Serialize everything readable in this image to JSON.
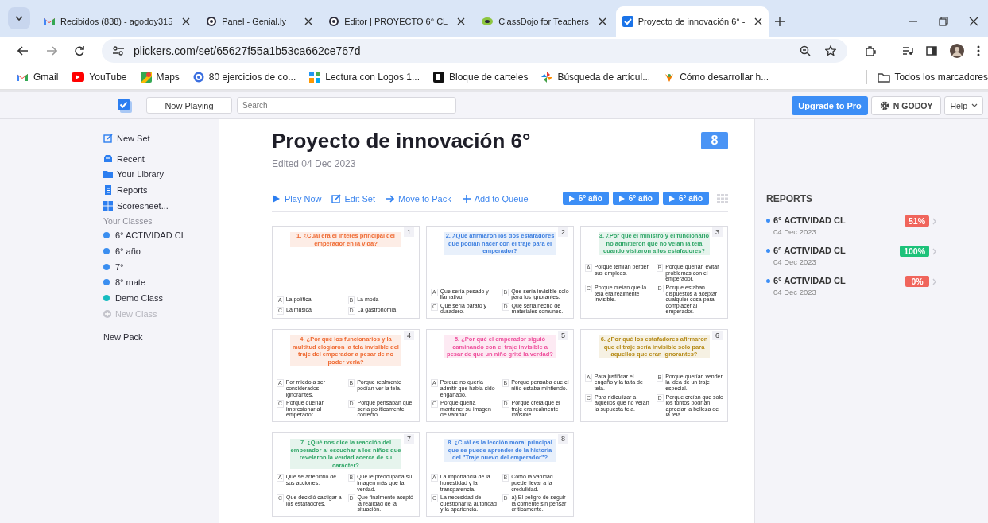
{
  "browser": {
    "tabs": [
      {
        "title": "Recibidos (838) - agodoy315",
        "selected": false
      },
      {
        "title": "Panel - Genial.ly",
        "selected": false
      },
      {
        "title": "Editor | PROYECTO 6° CL",
        "selected": false
      },
      {
        "title": "ClassDojo for Teachers",
        "selected": false
      },
      {
        "title": "Proyecto de innovación 6° -",
        "selected": true
      }
    ],
    "address": "plickers.com/set/65627f55a1b53ca662ce767d",
    "bookmarks": [
      "Gmail",
      "YouTube",
      "Maps",
      "80 ejercicios de co...",
      "Lectura con Logos 1...",
      "Bloque de carteles",
      "Búsqueda de artícul...",
      "Cómo desarrollar h..."
    ],
    "all_bookmarks": "Todos los marcadores"
  },
  "app_header": {
    "now_playing": "Now Playing",
    "search": {
      "placeholder": "Search"
    },
    "upgrade": "Upgrade to Pro",
    "user": "N GODOY",
    "help": "Help"
  },
  "sidebar": {
    "new_set": "New Set",
    "nav": [
      "Recent",
      "Your Library",
      "Reports",
      "Scoresheet..."
    ],
    "classes_heading": "Your Classes",
    "classes": [
      {
        "name": "6° ACTIVIDAD CL",
        "color": "#3a8ef0"
      },
      {
        "name": "6° año",
        "color": "#3a8ef0"
      },
      {
        "name": "7°",
        "color": "#3a8ef0"
      },
      {
        "name": "8° mate",
        "color": "#3a8ef0"
      },
      {
        "name": "Demo Class",
        "color": "#16bcc0"
      }
    ],
    "new_class": "New Class",
    "new_pack": "New Pack"
  },
  "set": {
    "title": "Proyecto de innovación 6°",
    "edited": "Edited 04 Dec 2023",
    "count": "8",
    "actions": [
      "Play Now",
      "Edit Set",
      "Move to Pack",
      "Add to Queue"
    ],
    "play_buttons": [
      "6° año",
      "6° año",
      "6° año"
    ],
    "questions": [
      {
        "number": "1",
        "text": "1. ¿Cuál era el interés principal del emperador en la vida?",
        "color": "#ef6a32",
        "choices": [
          {
            "letter": "A",
            "text": "La política"
          },
          {
            "letter": "B",
            "text": "La moda"
          },
          {
            "letter": "C",
            "text": "La música"
          },
          {
            "letter": "D",
            "text": "La gastronomía"
          }
        ]
      },
      {
        "number": "2",
        "text": "2. ¿Qué afirmaron los dos estafadores que podían hacer con el traje para el emperador?",
        "color": "#3f80e0",
        "choices": [
          {
            "letter": "A",
            "text": "Que sería pesado y llamativo."
          },
          {
            "letter": "B",
            "text": "Que sería invisible solo para los ignorantes."
          },
          {
            "letter": "C",
            "text": "Que sería barato y duradero."
          },
          {
            "letter": "D",
            "text": "Que sería hecho de materiales comunes."
          }
        ]
      },
      {
        "number": "3",
        "text": "3. ¿Por qué el ministro y el funcionario no admitieron que no veían la tela cuando visitaron a los estafadores?",
        "color": "#2fa667",
        "choices": [
          {
            "letter": "A",
            "text": "Porque temían perder sus empleos."
          },
          {
            "letter": "B",
            "text": "Porque querían evitar problemas con el emperador."
          },
          {
            "letter": "C",
            "text": "Porque creían que la tela era realmente invisible."
          },
          {
            "letter": "D",
            "text": "Porque estaban dispuestos a aceptar cualquier cosa para complacer al emperador."
          }
        ]
      },
      {
        "number": "4",
        "text": "4. ¿Por qué los funcionarios y la multitud elogiaron la tela invisible del traje del emperador a pesar de no poder verla?",
        "color": "#ef6a32",
        "choices": [
          {
            "letter": "A",
            "text": "Por miedo a ser considerados ignorantes."
          },
          {
            "letter": "B",
            "text": "Porque realmente podían ver la tela."
          },
          {
            "letter": "C",
            "text": "Porque querían impresionar al emperador."
          },
          {
            "letter": "D",
            "text": "Porque pensaban que sería políticamente correcto."
          }
        ]
      },
      {
        "number": "5",
        "text": "5. ¿Por qué el emperador siguió caminando con el traje invisible a pesar de que un niño gritó la verdad?",
        "color": "#ee4f9c",
        "choices": [
          {
            "letter": "A",
            "text": "Porque no quería admitir que había sido engañado."
          },
          {
            "letter": "B",
            "text": "Porque pensaba que el niño estaba mintiendo."
          },
          {
            "letter": "C",
            "text": "Porque quería mantener su imagen de vanidad."
          },
          {
            "letter": "D",
            "text": "Porque creía que el traje era realmente invisible."
          }
        ]
      },
      {
        "number": "6",
        "text": "6. ¿Por qué los estafadores afirmaron que el traje sería invisible solo para aquellos que eran ignorantes?",
        "color": "#b58a16",
        "choices": [
          {
            "letter": "A",
            "text": "Para justificar el engaño y la falta de tela."
          },
          {
            "letter": "B",
            "text": "Porque querían vender la idea de un traje especial."
          },
          {
            "letter": "C",
            "text": "Para ridiculizar a aquellos que no veían la supuesta tela."
          },
          {
            "letter": "D",
            "text": "Porque creían que solo los tontos podrían apreciar la belleza de la tela."
          }
        ]
      },
      {
        "number": "7",
        "text": "7. ¿Qué nos dice la reacción del emperador al escuchar a los niños que revelaron la verdad acerca de su carácter?",
        "color": "#2fa667",
        "choices": [
          {
            "letter": "A",
            "text": "Que se arrepintió de sus acciones."
          },
          {
            "letter": "B",
            "text": "Que le preocupaba su imagen más que la verdad."
          },
          {
            "letter": "C",
            "text": "Que decidió castigar a los estafadores."
          },
          {
            "letter": "D",
            "text": "Que finalmente aceptó la realidad de la situación."
          }
        ]
      },
      {
        "number": "8",
        "text": "8. ¿Cuál es la lección moral principal que se puede aprender de la historia del \"Traje nuevo del emperador\"?",
        "color": "#3f80e0",
        "choices": [
          {
            "letter": "A",
            "text": "La importancia de la honestidad y la transparencia."
          },
          {
            "letter": "B",
            "text": "Cómo la vanidad puede llevar a la credulidad."
          },
          {
            "letter": "C",
            "text": "La necesidad de cuestionar la autoridad y la apariencia."
          },
          {
            "letter": "D",
            "text": "a) El peligro de seguir la corriente sin pensar críticamente."
          }
        ]
      }
    ]
  },
  "reports": {
    "heading": "REPORTS",
    "items": [
      {
        "name": "6° ACTIVIDAD CL",
        "date": "04 Dec 2023",
        "score": "51%",
        "color": "#f0655c"
      },
      {
        "name": "6° ACTIVIDAD CL",
        "date": "04 Dec 2023",
        "score": "100%",
        "color": "#1dc27a"
      },
      {
        "name": "6° ACTIVIDAD CL",
        "date": "04 Dec 2023",
        "score": "0%",
        "color": "#f0655c"
      }
    ]
  }
}
